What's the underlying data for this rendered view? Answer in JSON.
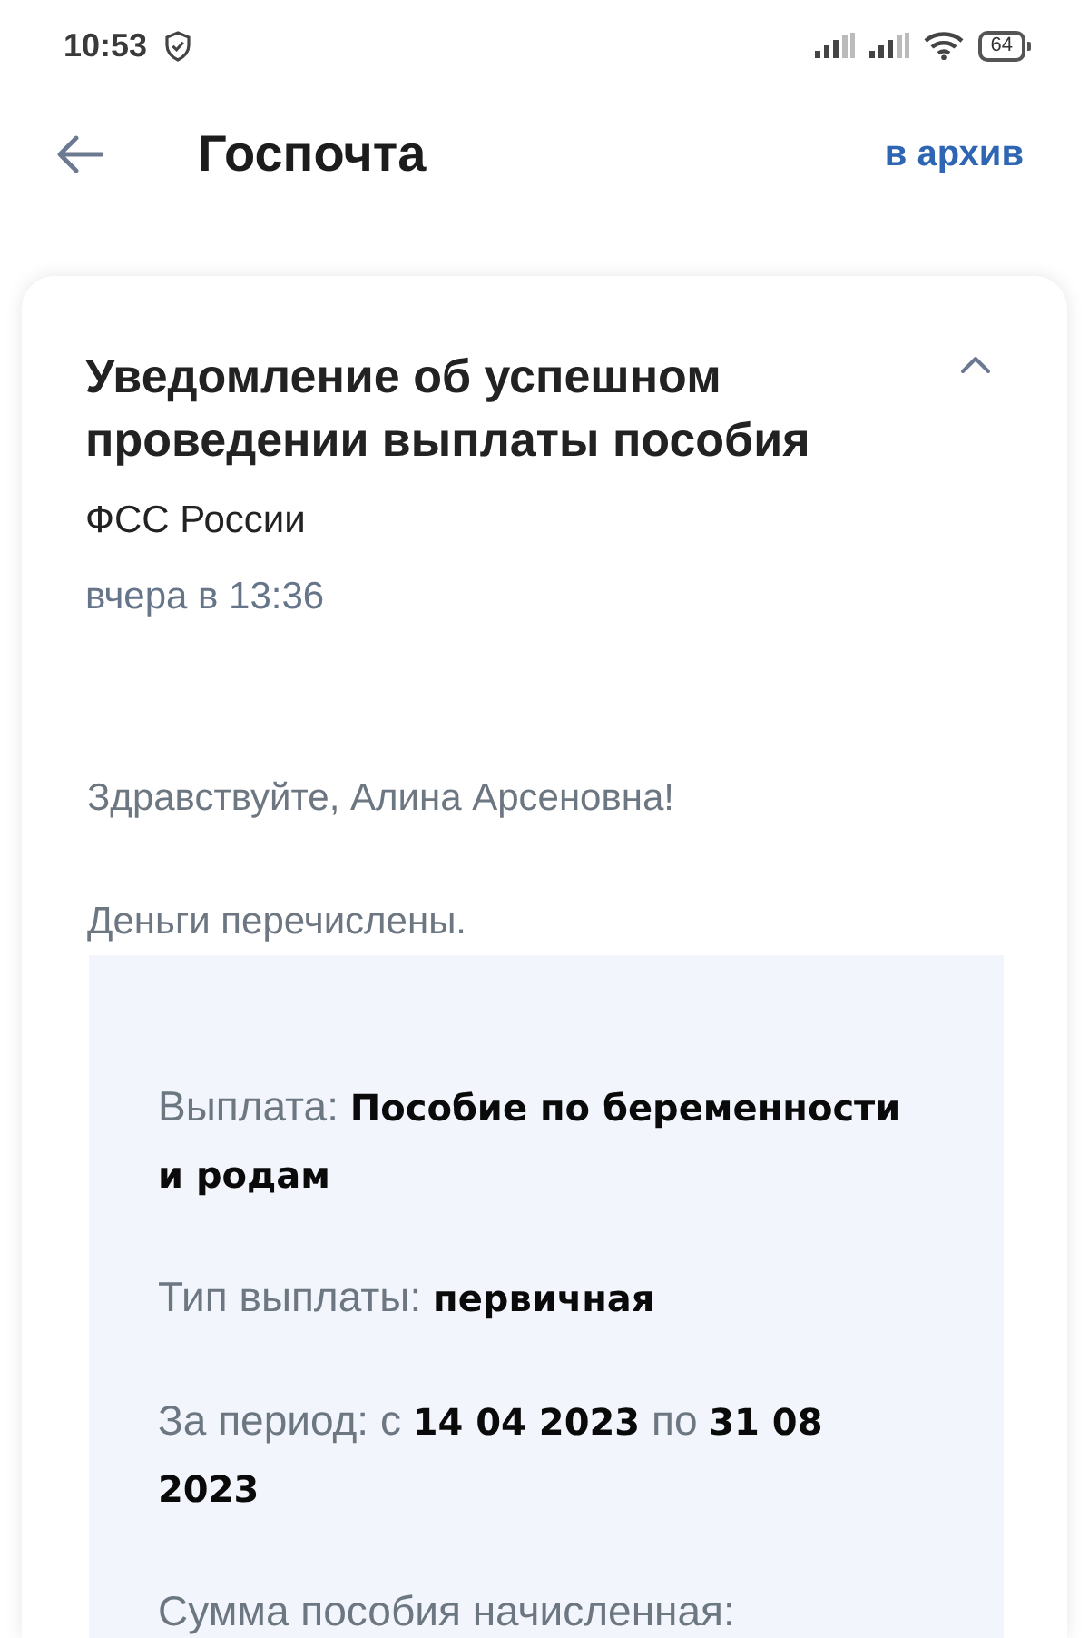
{
  "status_bar": {
    "time": "10:53",
    "battery": "64"
  },
  "header": {
    "title": "Госпочта",
    "action": "в архив"
  },
  "message": {
    "title": "Уведомление об успешном проведении выплаты пособия",
    "expanded": true,
    "sender": "ФСС России",
    "date": "вчера в 13:36",
    "paragraphs": [
      "Здравствуйте, Алина Арсеновна!",
      "Деньги перечислены."
    ],
    "details": [
      "Выплата: **Пособие по беременности и родам**",
      "Тип выплаты: **первичная**",
      "За период: с **14 04 2023** по **31 08 2023**",
      "Сумма пособия начисленная:"
    ]
  }
}
